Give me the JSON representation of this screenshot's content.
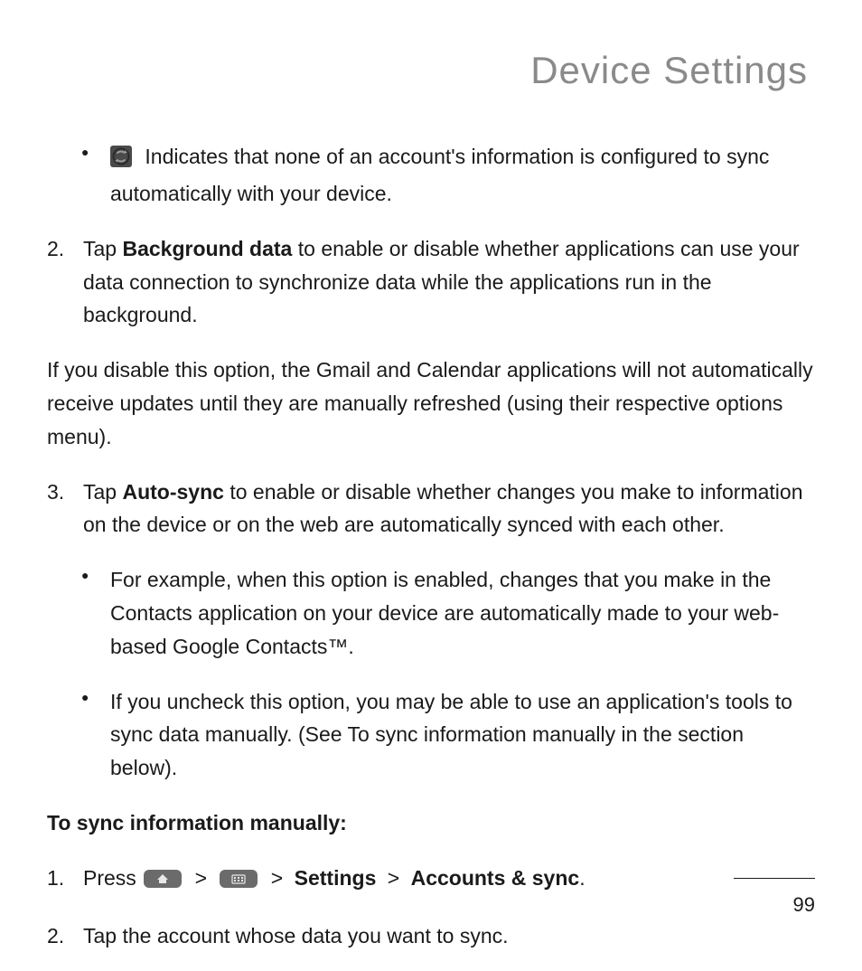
{
  "title": "Device Settings",
  "top_bullet": {
    "icon": "sync-off-icon",
    "text": "Indicates that none of an account's information is configured to sync automatically with your device."
  },
  "step2": {
    "num": "2.",
    "lead": "Tap ",
    "bold": "Background data",
    "rest": " to enable or disable whether applications can use your data connection to synchronize data while the applications run in the background."
  },
  "disable_note": "If you disable this option, the Gmail and Calendar applications will not automatically receive updates until they are manually refreshed (using their respective options menu).",
  "step3": {
    "num": "3.",
    "lead": "Tap ",
    "bold": "Auto-sync",
    "rest": " to enable or disable whether changes you make to information on the device or on the web are automatically synced with each other.",
    "sub_bullets": [
      "For example, when this option is enabled, changes that you make in the Contacts application on your device are automatically made to your web-based Google Contacts™.",
      "If you uncheck this option, you may be able to use an application's tools to sync data manually. (See To sync information manually in the section below)."
    ]
  },
  "manual_heading": "To sync information manually:",
  "manual1": {
    "num": "1.",
    "press": "Press ",
    "sep": ">",
    "settings": "Settings",
    "accounts": "Accounts & sync",
    "end": "."
  },
  "manual2": {
    "num": "2.",
    "text": "Tap the account whose data you want to sync."
  },
  "page_number": "99"
}
